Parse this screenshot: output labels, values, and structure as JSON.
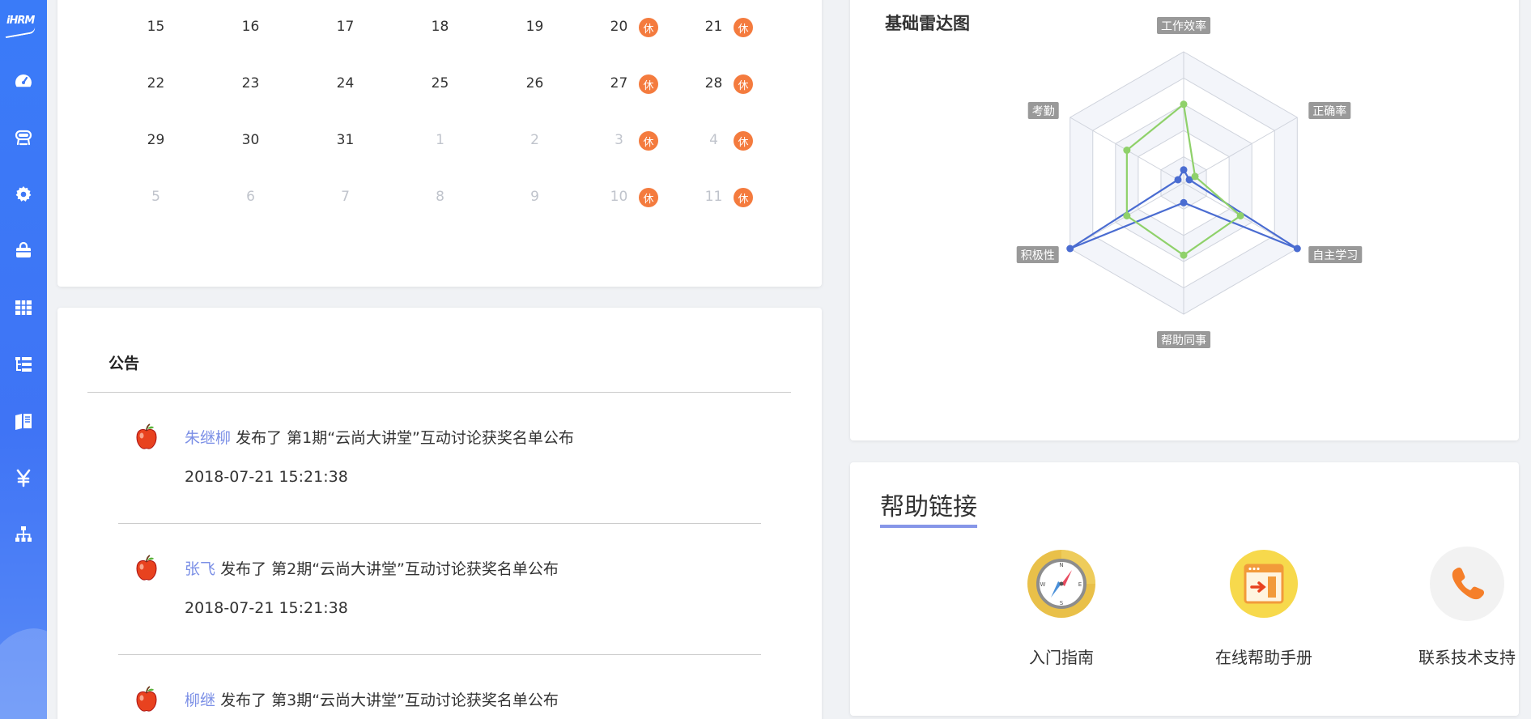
{
  "sidebar": {
    "logo_text": "iHRM",
    "items": [
      {
        "icon": "dashboard-icon"
      },
      {
        "icon": "employee-icon"
      },
      {
        "icon": "settings-icon"
      },
      {
        "icon": "toolbox-icon"
      },
      {
        "icon": "table-icon"
      },
      {
        "icon": "list-tree-icon"
      },
      {
        "icon": "book-icon"
      },
      {
        "icon": "yen-icon"
      },
      {
        "icon": "org-chart-icon"
      }
    ]
  },
  "calendar": {
    "rest_label": "休",
    "rows": [
      {
        "days": [
          {
            "d": "15",
            "muted": false,
            "rest": false
          },
          {
            "d": "16",
            "muted": false,
            "rest": false
          },
          {
            "d": "17",
            "muted": false,
            "rest": false
          },
          {
            "d": "18",
            "muted": false,
            "rest": false
          },
          {
            "d": "19",
            "muted": false,
            "rest": false
          },
          {
            "d": "20",
            "muted": false,
            "rest": true
          },
          {
            "d": "21",
            "muted": false,
            "rest": true
          }
        ]
      },
      {
        "days": [
          {
            "d": "22",
            "muted": false,
            "rest": false
          },
          {
            "d": "23",
            "muted": false,
            "rest": false
          },
          {
            "d": "24",
            "muted": false,
            "rest": false
          },
          {
            "d": "25",
            "muted": false,
            "rest": false
          },
          {
            "d": "26",
            "muted": false,
            "rest": false
          },
          {
            "d": "27",
            "muted": false,
            "rest": true
          },
          {
            "d": "28",
            "muted": false,
            "rest": true
          }
        ]
      },
      {
        "days": [
          {
            "d": "29",
            "muted": false,
            "rest": false
          },
          {
            "d": "30",
            "muted": false,
            "rest": false
          },
          {
            "d": "31",
            "muted": false,
            "rest": false
          },
          {
            "d": "1",
            "muted": true,
            "rest": false
          },
          {
            "d": "2",
            "muted": true,
            "rest": false
          },
          {
            "d": "3",
            "muted": true,
            "rest": true
          },
          {
            "d": "4",
            "muted": true,
            "rest": true
          }
        ]
      },
      {
        "days": [
          {
            "d": "5",
            "muted": true,
            "rest": false
          },
          {
            "d": "6",
            "muted": true,
            "rest": false
          },
          {
            "d": "7",
            "muted": true,
            "rest": false
          },
          {
            "d": "8",
            "muted": true,
            "rest": false
          },
          {
            "d": "9",
            "muted": true,
            "rest": false
          },
          {
            "d": "10",
            "muted": true,
            "rest": true
          },
          {
            "d": "11",
            "muted": true,
            "rest": true
          }
        ]
      }
    ]
  },
  "notice": {
    "title": "公告",
    "items": [
      {
        "author": "朱继柳",
        "action": "发布了",
        "text": "第1期“云尚大讲堂”互动讨论获奖名单公布",
        "time": "2018-07-21 15:21:38"
      },
      {
        "author": "张飞",
        "action": "发布了",
        "text": "第2期“云尚大讲堂”互动讨论获奖名单公布",
        "time": "2018-07-21 15:21:38"
      },
      {
        "author": "柳继",
        "action": "发布了",
        "text": "第3期“云尚大讲堂”互动讨论获奖名单公布",
        "time": ""
      }
    ]
  },
  "radar": {
    "title": "基础雷达图",
    "indicators": [
      "工作效率",
      "正确率",
      "自主学习",
      "帮助同事",
      "积极性",
      "考勤"
    ],
    "max": 100,
    "colors": {
      "series_a": "#4a6cd1",
      "series_b": "#8fd16a",
      "grid": "#cfd3dc",
      "band": "#f3f5fa",
      "label_bg": "#999999"
    },
    "series": [
      {
        "values": [
          10,
          5,
          100,
          15,
          100,
          5
        ]
      },
      {
        "values": [
          60,
          10,
          50,
          55,
          50,
          50
        ]
      }
    ]
  },
  "help": {
    "title": "帮助链接",
    "items": [
      {
        "label": "入门指南",
        "icon": "compass-icon"
      },
      {
        "label": "在线帮助手册",
        "icon": "manual-icon"
      },
      {
        "label": "联系技术支持",
        "icon": "phone-icon"
      }
    ]
  }
}
